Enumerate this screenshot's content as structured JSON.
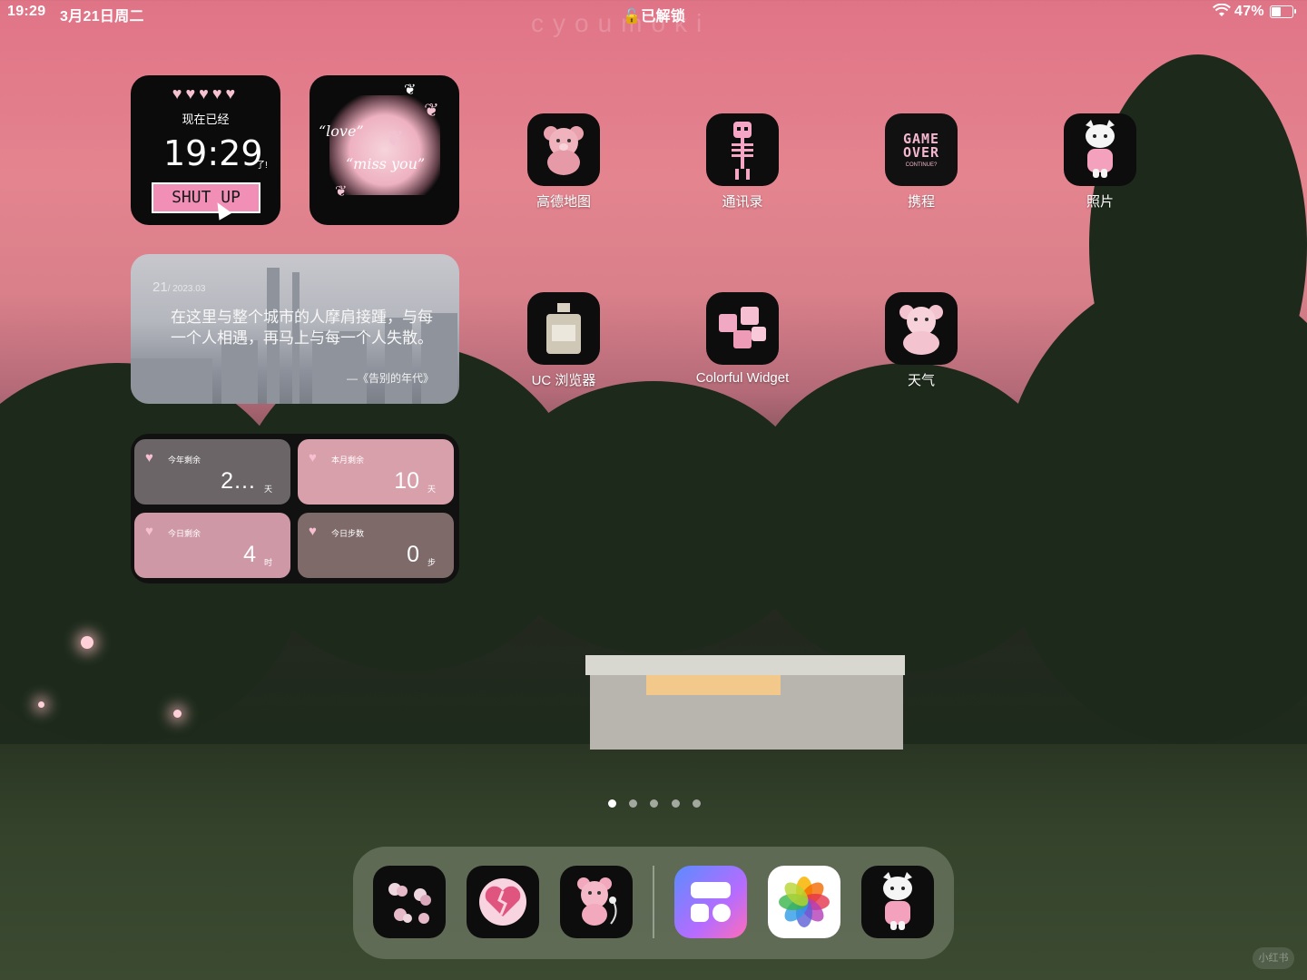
{
  "status_bar": {
    "time": "19:29",
    "date": "3月21日周二",
    "lock_text": "已解锁",
    "battery": "47%",
    "battery_level": 0.47
  },
  "watermark": "cyoumoki",
  "clock_widget": {
    "hearts": "♥♥♥♥♥",
    "subtitle": "现在已经",
    "time": "19:29",
    "suffix": "了!",
    "button": "SHUT UP"
  },
  "love_widget": {
    "line1": "“love”",
    "line2": "“miss you”"
  },
  "quote_widget": {
    "day": "21",
    "date": "/ 2023.03",
    "text": "在这里与整个城市的人摩肩接踵，与每一个人相遇，再马上与每一个人失散。",
    "source": "—《告别的年代》"
  },
  "countdown_widget": {
    "cells": [
      {
        "label": "今年剩余",
        "value": "2…",
        "unit": "天",
        "color": "#6b6567"
      },
      {
        "label": "本月剩余",
        "value": "10",
        "unit": "天",
        "color": "#d8a0ab"
      },
      {
        "label": "今日剩余",
        "value": "4",
        "unit": "时",
        "color": "#cf98a7"
      },
      {
        "label": "今日步数",
        "value": "0",
        "unit": "步",
        "color": "#7f6a6a"
      }
    ]
  },
  "apps": [
    {
      "label": "高德地图",
      "icon": "pink-bear-icon"
    },
    {
      "label": "通讯录",
      "icon": "pink-skeleton-icon"
    },
    {
      "label": "携程",
      "icon": "game-over-icon",
      "icon_text": "GAME OVER",
      "icon_sub": "CONTINUE?"
    },
    {
      "label": "照片",
      "icon": "kitty-plush-icon"
    },
    {
      "label": "UC 浏览器",
      "icon": "perfume-icon"
    },
    {
      "label": "Colorful Widget",
      "icon": "pink-cubes-icon"
    },
    {
      "label": "天气",
      "icon": "teddy-icon"
    }
  ],
  "page_dots": {
    "count": 5,
    "active": 0
  },
  "dock": {
    "icons": [
      "butterflies-icon",
      "broken-heart-icon",
      "bear-headphones-icon",
      "widget-layout-icon",
      "photos-flower-icon",
      "kitty-plush-icon"
    ]
  },
  "colors": {
    "sky": "#e07487",
    "accent_pink": "#f28fb6",
    "dock": "#6e7864"
  },
  "corner_mark": "小红书"
}
